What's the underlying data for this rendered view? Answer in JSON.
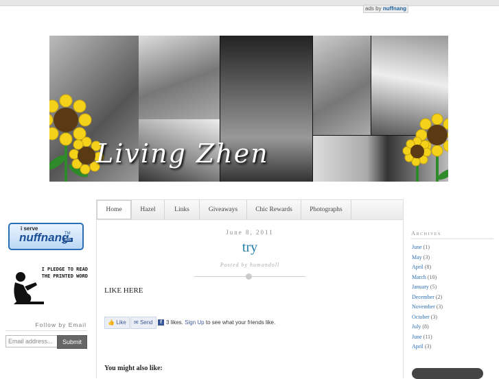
{
  "ad_attribution": {
    "prefix": "ads by",
    "brand": "nuffnang"
  },
  "header": {
    "blog_title": "Living Zhen"
  },
  "sidebar_left": {
    "nuffnang_badge": {
      "serve_text": "i serve",
      "brand": "nuffnang",
      "tm": "TM",
      "ads": "ads"
    },
    "pledge_text_line1": "I PLEDGE TO READ",
    "pledge_text_line2": "THE PRINTED WORD",
    "follow_title": "Follow by Email",
    "email_placeholder": "Email address...",
    "submit_label": "Submit"
  },
  "nav": {
    "tabs": [
      {
        "label": "Home",
        "active": true
      },
      {
        "label": "Hazel"
      },
      {
        "label": "Links"
      },
      {
        "label": "Giveaways"
      },
      {
        "label": "Chic Rewards"
      },
      {
        "label": "Photographs"
      }
    ]
  },
  "post": {
    "date": "June 8, 2011",
    "title": "try",
    "posted_by": "Posted by humandoll",
    "body": "LIKE HERE",
    "fb_like_label": "Like",
    "fb_send_label": "Send",
    "fb_likes_text": "3 likes.",
    "fb_signup_link": "Sign Up",
    "fb_suffix": "to see what your friends like.",
    "you_might_also_like": "You might also like:"
  },
  "sidebar_right": {
    "archives_title": "Archives",
    "archives": [
      {
        "month": "June",
        "count": "(1)"
      },
      {
        "month": "May",
        "count": "(3)"
      },
      {
        "month": "April",
        "count": "(8)"
      },
      {
        "month": "March",
        "count": "(10)"
      },
      {
        "month": "January",
        "count": "(5)"
      },
      {
        "month": "December",
        "count": "(2)"
      },
      {
        "month": "November",
        "count": "(3)"
      },
      {
        "month": "October",
        "count": "(3)"
      },
      {
        "month": "July",
        "count": "(8)"
      },
      {
        "month": "June",
        "count": "(11)"
      },
      {
        "month": "April",
        "count": "(3)"
      }
    ]
  },
  "colors": {
    "link": "#2a6fb5",
    "title": "#1e7fab",
    "facebook": "#3b5998",
    "sunflower": "#f5d21a"
  }
}
